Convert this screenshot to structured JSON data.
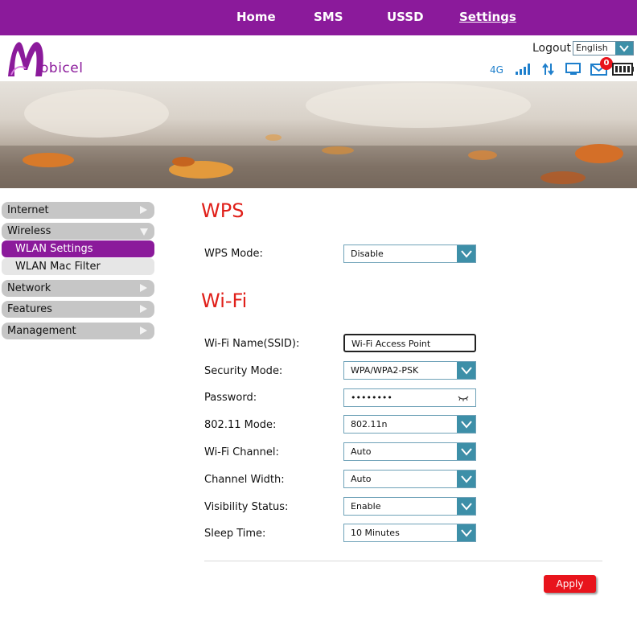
{
  "nav": {
    "items": [
      "Home",
      "SMS",
      "USSD",
      "Settings"
    ],
    "active": "Settings"
  },
  "header": {
    "logo_text": "obicel",
    "logout_label": "Logout",
    "language": {
      "selected": "English"
    },
    "status": {
      "network_type": "4G",
      "sms_count": "0"
    }
  },
  "sidebar": {
    "items": [
      {
        "label": "Internet"
      },
      {
        "label": "Wireless"
      },
      {
        "label": "Network"
      },
      {
        "label": "Features"
      },
      {
        "label": "Management"
      }
    ],
    "wireless_sub": [
      {
        "label": "WLAN Settings"
      },
      {
        "label": "WLAN Mac Filter"
      }
    ]
  },
  "wps": {
    "title": "WPS",
    "mode_label": "WPS Mode:",
    "mode_value": "Disable"
  },
  "wifi": {
    "title": "Wi-Fi",
    "fields": [
      {
        "label": "Wi-Fi Name(SSID):",
        "value": "Wi-Fi Access Point"
      },
      {
        "label": "Security Mode:",
        "value": "WPA/WPA2-PSK"
      },
      {
        "label": "Password:",
        "value": "••••••••"
      },
      {
        "label": "802.11 Mode:",
        "value": "802.11n"
      },
      {
        "label": "Wi-Fi Channel:",
        "value": "Auto"
      },
      {
        "label": "Channel Width:",
        "value": "Auto"
      },
      {
        "label": "Visibility Status:",
        "value": "Enable"
      },
      {
        "label": "Sleep Time:",
        "value": "10 Minutes"
      }
    ]
  },
  "apply_label": "Apply",
  "colors": {
    "brand": "#8b1a9b",
    "accent": "#3d8fa8",
    "title": "#e0201a",
    "apply": "#e8141c",
    "status_icons": "#1e7fcc"
  },
  "icons": [
    "signal-icon",
    "data-transfer-icon",
    "monitor-icon",
    "mail-icon",
    "battery-icon",
    "chevron-down-icon",
    "triangle-right-icon",
    "eye-closed-icon"
  ]
}
